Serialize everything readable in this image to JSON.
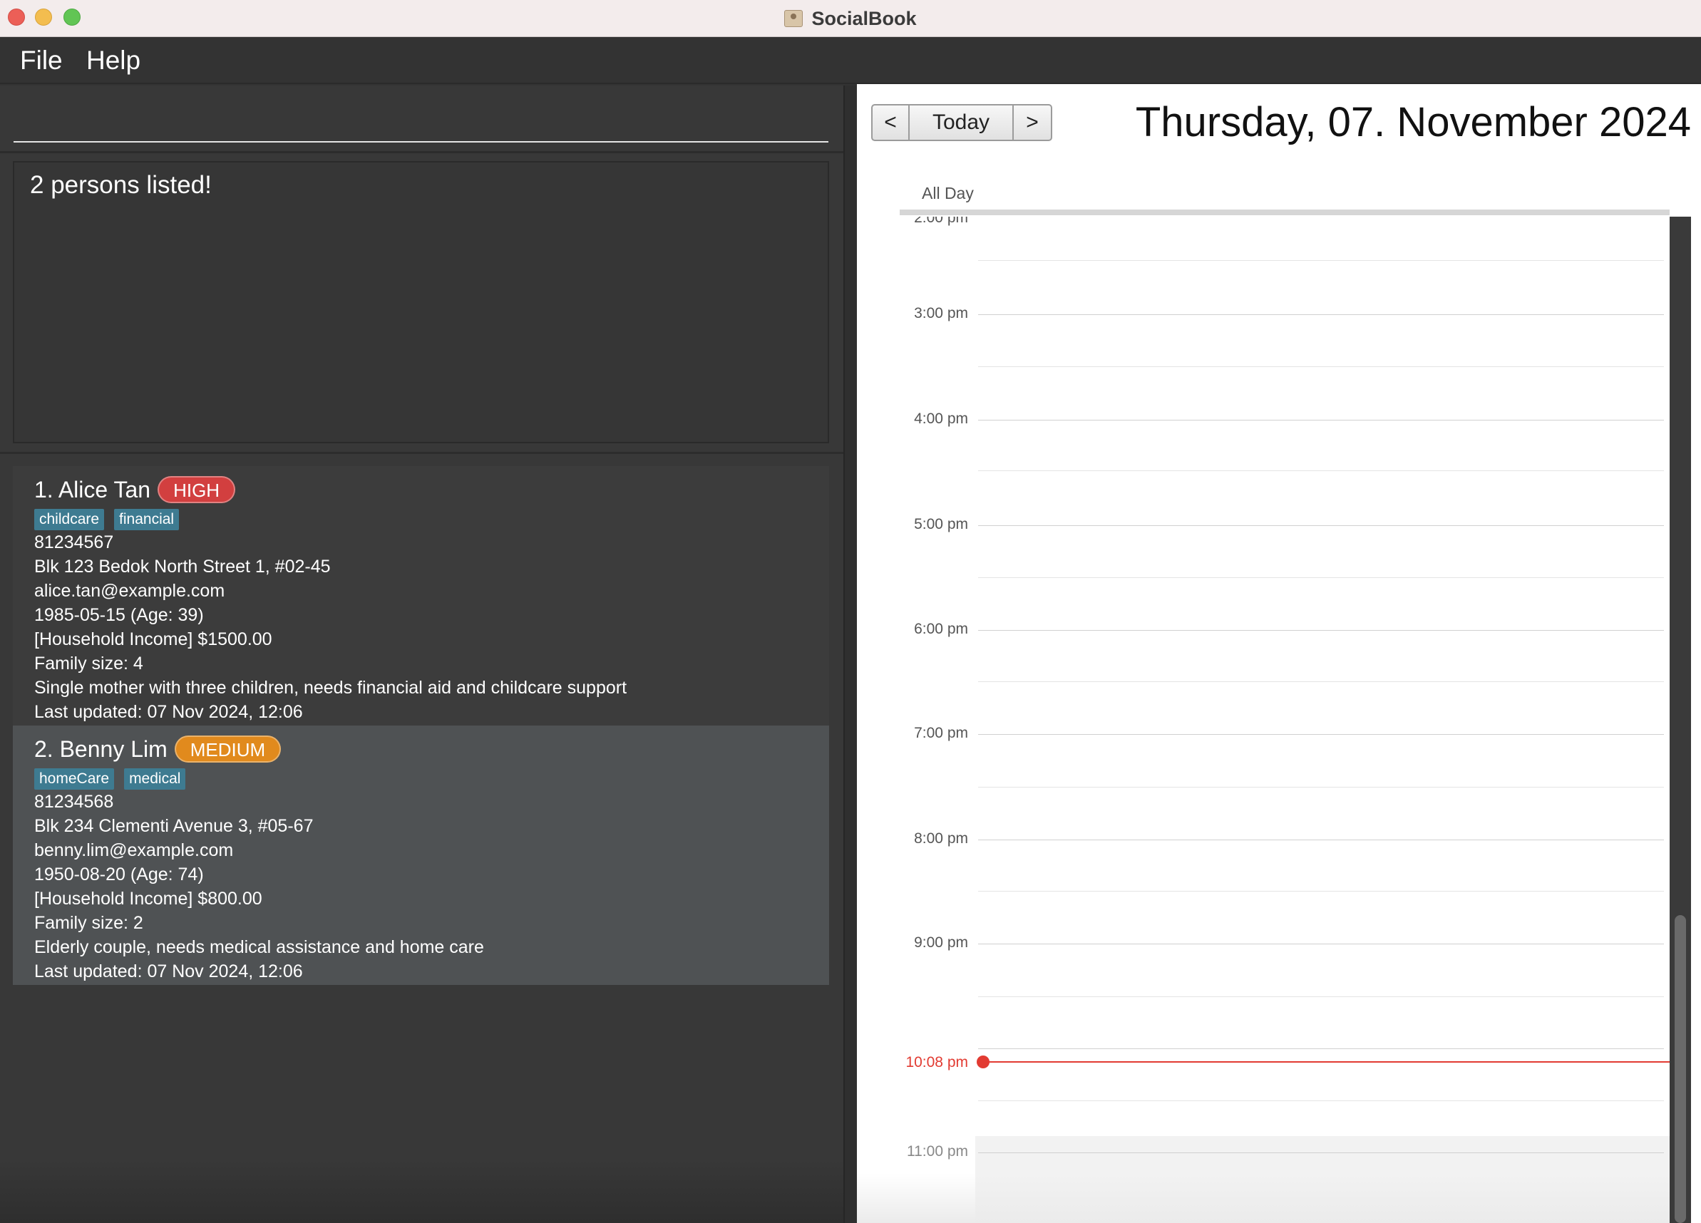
{
  "window": {
    "title": "SocialBook",
    "controls": [
      "close",
      "minimize",
      "maximize"
    ]
  },
  "menu": {
    "file_label": "File",
    "help_label": "Help"
  },
  "command": {
    "value": ""
  },
  "result": {
    "message": "2 persons listed!"
  },
  "persons": [
    {
      "name": "1. Alice Tan",
      "priority": "HIGH",
      "tags": [
        "childcare",
        "financial"
      ],
      "phone": "81234567",
      "address": "Blk 123 Bedok North Street 1, #02-45",
      "email": "alice.tan@example.com",
      "dob": "1985-05-15 (Age: 39)",
      "income": "[Household Income] $1500.00",
      "family_size": "Family size: 4",
      "remark": "Single mother with three children, needs financial aid and childcare support",
      "updated": "Last updated: 07 Nov 2024, 12:06"
    },
    {
      "name": "2. Benny Lim",
      "priority": "MEDIUM",
      "tags": [
        "homeCare",
        "medical"
      ],
      "phone": "81234568",
      "address": "Blk 234 Clementi Avenue 3, #05-67",
      "email": "benny.lim@example.com",
      "dob": "1950-08-20 (Age: 74)",
      "income": "[Household Income] $800.00",
      "family_size": "Family size: 2",
      "remark": "Elderly couple, needs medical assistance and home care",
      "updated": "Last updated: 07 Nov 2024, 12:06"
    }
  ],
  "calendar": {
    "prev_label": "<",
    "today_label": "Today",
    "next_label": ">",
    "date": "Thursday, 07. November 2024",
    "all_day_label": "All Day",
    "partial_label": "2:00 pm",
    "hours": [
      "3:00 pm",
      "4:00 pm",
      "5:00 pm",
      "6:00 pm",
      "7:00 pm",
      "8:00 pm",
      "9:00 pm",
      "11:00 pm"
    ],
    "now_label": "10:08 pm",
    "now_color": "#e23b32"
  },
  "colors": {
    "priority_high": "#d23f3f",
    "priority_medium": "#e18a1d",
    "tag": "#3e7b91",
    "panel_bg": "#383838"
  }
}
